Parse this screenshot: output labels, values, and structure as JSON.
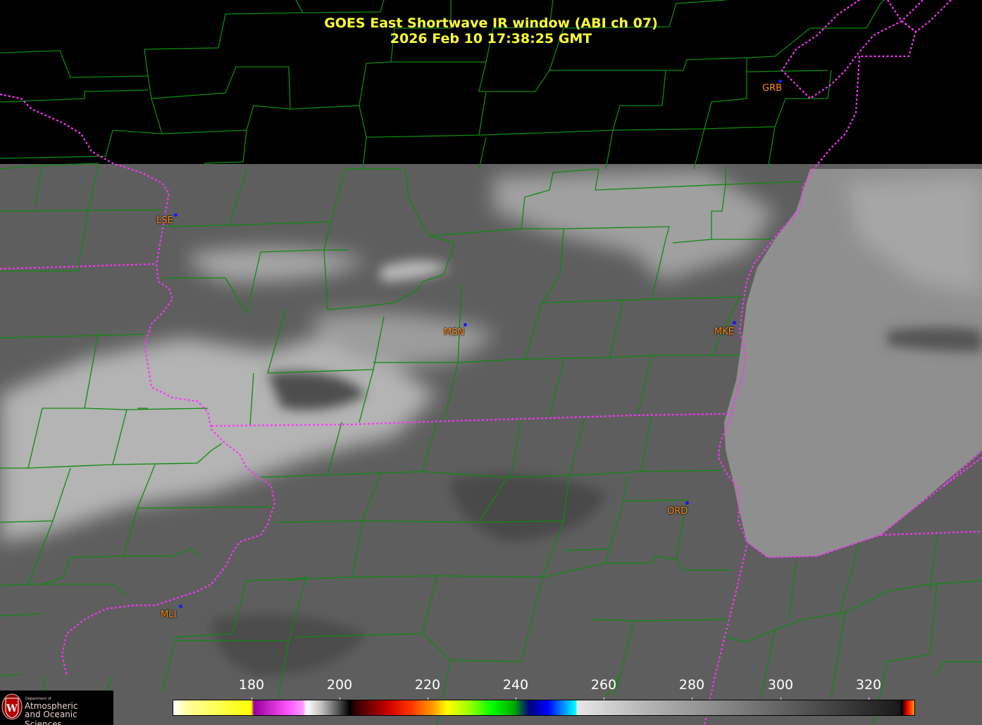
{
  "title": {
    "line1": "GOES East Shortwave IR window (ABI ch 07)",
    "line2": "2026 Feb 10  17:38:25 GMT"
  },
  "colors": {
    "title": "#ffff33",
    "station_label": "#ff8c1a",
    "station_dot": "#1a1aff",
    "county_lines": "#0d8a0d",
    "state_borders": "#ff33ff",
    "background": "#000000"
  },
  "stations": [
    {
      "id": "GRB",
      "label": "GRB"
    },
    {
      "id": "LSE",
      "label": "LSE"
    },
    {
      "id": "MSN",
      "label": "MSN"
    },
    {
      "id": "MKE",
      "label": "MKE"
    },
    {
      "id": "ORD",
      "label": "ORD"
    },
    {
      "id": "MLI",
      "label": "MLI"
    }
  ],
  "colorbar": {
    "unit_note": "",
    "ticks": [
      "180",
      "200",
      "220",
      "240",
      "260",
      "280",
      "300",
      "320"
    ]
  },
  "logo": {
    "small": "Department of",
    "line1": "Atmospheric",
    "line2": "and Oceanic Sciences"
  }
}
